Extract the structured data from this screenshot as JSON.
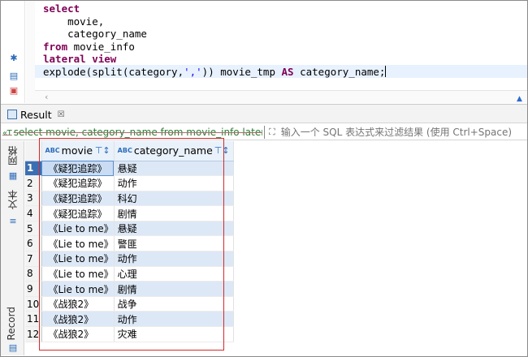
{
  "editor": {
    "code_lines": [
      [
        {
          "t": "kw",
          "v": "select"
        }
      ],
      [
        {
          "t": "tx",
          "v": "    movie,"
        }
      ],
      [
        {
          "t": "tx",
          "v": "    category_name"
        }
      ],
      [
        {
          "t": "kw",
          "v": "from"
        },
        {
          "t": "tx",
          "v": " movie_info"
        }
      ],
      [
        {
          "t": "kw",
          "v": "lateral view"
        }
      ],
      [
        {
          "t": "tx",
          "v": "explode(split(category,"
        },
        {
          "t": "str",
          "v": "','"
        },
        {
          "t": "tx",
          "v": ")) movie_tmp "
        },
        {
          "t": "kw",
          "v": "AS"
        },
        {
          "t": "tx",
          "v": " category_name;"
        }
      ]
    ],
    "gutter_icons": [
      "gear-icon",
      "script-icon",
      "script-run-icon"
    ]
  },
  "result_tab": {
    "label": "Result",
    "close_glyph": "☒"
  },
  "filter": {
    "query_icon": "«T",
    "query_text": "select movie, category_name from movie_info lateral",
    "placeholder": "输入一个 SQL 表达式来过滤结果 (使用 Ctrl+Space)"
  },
  "side_panel": {
    "grid_tab": "网格",
    "text_tab": "文本",
    "record_tab": "Record"
  },
  "grid": {
    "columns": [
      {
        "name": "movie",
        "type_icon": "ABC"
      },
      {
        "name": "category_name",
        "type_icon": "ABC"
      }
    ],
    "rows": [
      {
        "n": "1",
        "movie": "《疑犯追踪》",
        "category_name": "悬疑"
      },
      {
        "n": "2",
        "movie": "《疑犯追踪》",
        "category_name": "动作"
      },
      {
        "n": "3",
        "movie": "《疑犯追踪》",
        "category_name": "科幻"
      },
      {
        "n": "4",
        "movie": "《疑犯追踪》",
        "category_name": "剧情"
      },
      {
        "n": "5",
        "movie": "《Lie to me》",
        "category_name": "悬疑"
      },
      {
        "n": "6",
        "movie": "《Lie to me》",
        "category_name": "警匪"
      },
      {
        "n": "7",
        "movie": "《Lie to me》",
        "category_name": "动作"
      },
      {
        "n": "8",
        "movie": "《Lie to me》",
        "category_name": "心理"
      },
      {
        "n": "9",
        "movie": "《Lie to me》",
        "category_name": "剧情"
      },
      {
        "n": "10",
        "movie": "《战狼2》",
        "category_name": "战争"
      },
      {
        "n": "11",
        "movie": "《战狼2》",
        "category_name": "动作"
      },
      {
        "n": "12",
        "movie": "《战狼2》",
        "category_name": "灾难"
      }
    ],
    "selected_row": 1
  },
  "colors": {
    "keyword": "#7f0055",
    "string": "#2a00ff",
    "row_alt": "#dde8f7",
    "highlight_box": "#d42a2a",
    "filter_query": "#2e7d32"
  }
}
